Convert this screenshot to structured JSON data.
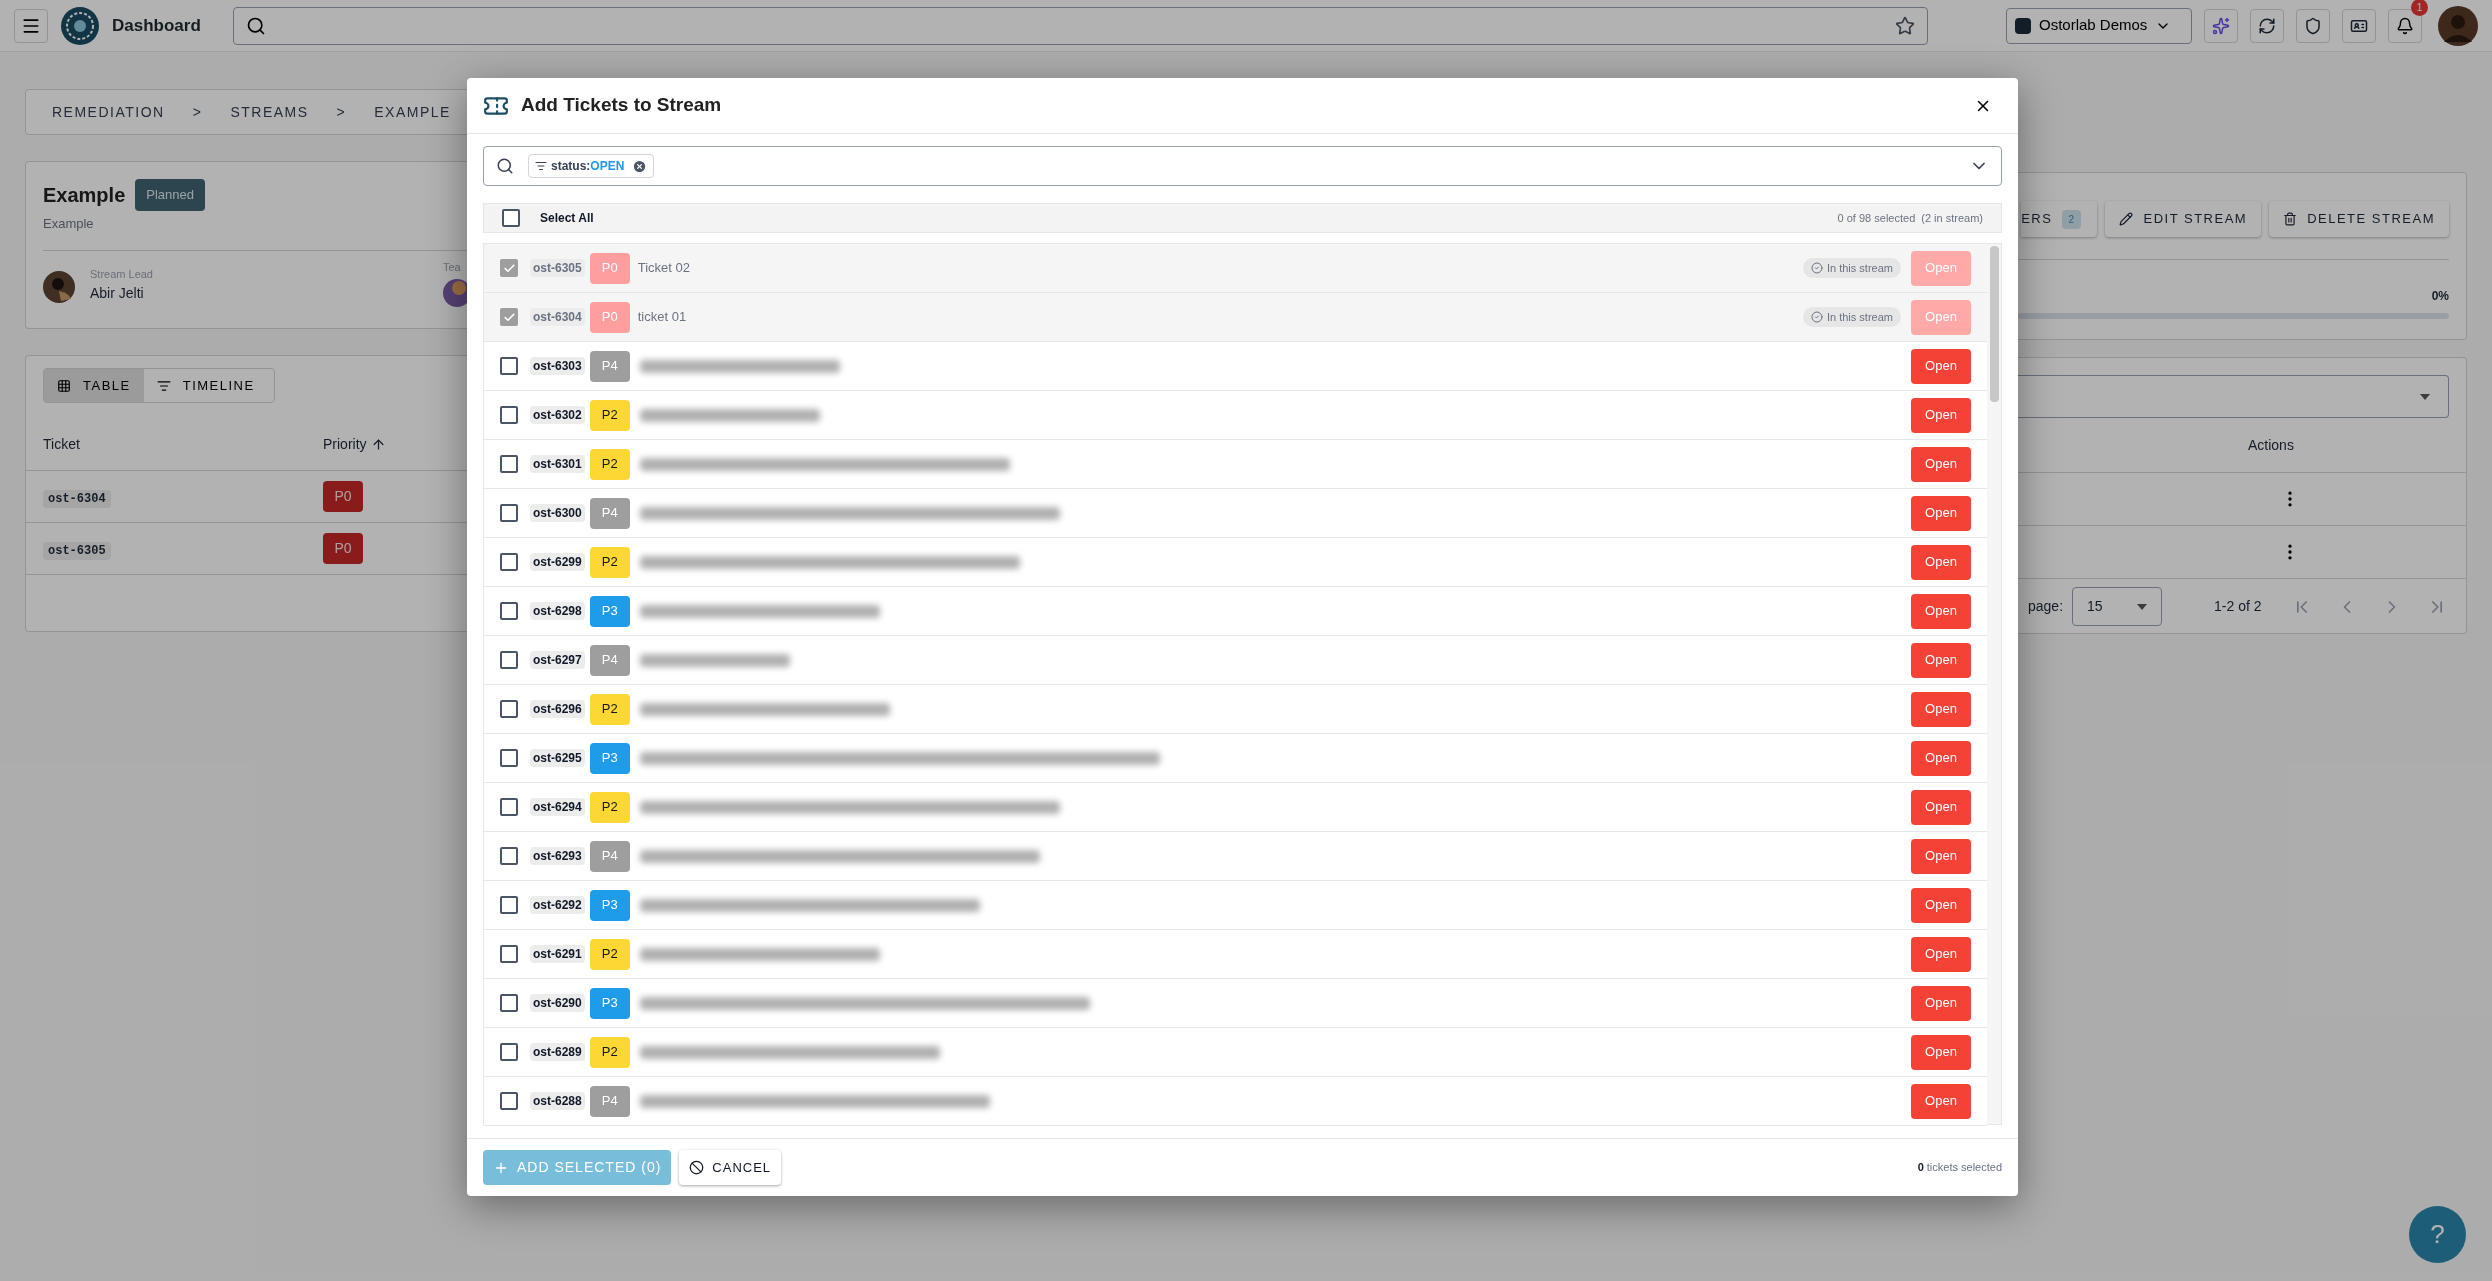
{
  "top_bar": {
    "title": "Dashboard",
    "org": "Ostorlab Demos",
    "notifications": "1"
  },
  "breadcrumb": [
    "REMEDIATION",
    ">",
    "STREAMS",
    ">",
    "EXAMPLE"
  ],
  "stream": {
    "name": "Example",
    "status": "Planned",
    "description": "Example",
    "lead_label": "Stream Lead",
    "lead": "Abir Jelti",
    "team_label": "Tea",
    "buttons": [
      {
        "kind": "count",
        "label": "ERS",
        "count": "2"
      },
      {
        "kind": "edit",
        "label": "EDIT STREAM"
      },
      {
        "kind": "delete",
        "label": "DELETE STREAM"
      }
    ],
    "progress": {
      "level": 0,
      "reading": "0%"
    }
  },
  "view_tabs": [
    {
      "kind": "table",
      "label": "TABLE",
      "selected": true
    },
    {
      "kind": "timeline",
      "label": "TIMELINE",
      "selected": false
    }
  ],
  "table": {
    "columns": [
      "Ticket",
      "Priority"
    ],
    "actions_column": "Actions",
    "rows": [
      {
        "ticket": "ost-6304",
        "priority": "P0"
      },
      {
        "ticket": "ost-6305",
        "priority": "P0"
      }
    ]
  },
  "pagination": {
    "rows_label": "page:",
    "per_page": "15",
    "range": "1-2 of 2"
  },
  "help": "?",
  "dialog": {
    "title": "Add Tickets to Stream",
    "filter": {
      "key": "status:",
      "value": "OPEN"
    },
    "select_all": {
      "label": "Select All",
      "checked": false
    },
    "selection_summary": "0 of 98 selected",
    "stream_summary": "(2 in stream)",
    "rows": [
      {
        "id": "ost-6305",
        "priority": "P0",
        "color": "#ff9e9e",
        "title": "Ticket 02",
        "note": "In this stream",
        "in_stream": true,
        "checked": true,
        "status": "Open"
      },
      {
        "id": "ost-6304",
        "priority": "P0",
        "color": "#ff9e9e",
        "title": "ticket 01",
        "note": "In this stream",
        "in_stream": true,
        "checked": true,
        "status": "Open"
      },
      {
        "id": "ost-6303",
        "priority": "P4",
        "color": "#9e9e9e",
        "title_blurred": true,
        "in_stream": false,
        "checked": false,
        "status": "Open"
      },
      {
        "id": "ost-6302",
        "priority": "P2",
        "color": "#fdd835",
        "title_blurred": true,
        "in_stream": false,
        "checked": false,
        "status": "Open"
      },
      {
        "id": "ost-6301",
        "priority": "P2",
        "color": "#fdd835",
        "title_blurred": true,
        "in_stream": false,
        "checked": false,
        "status": "Open"
      },
      {
        "id": "ost-6300",
        "priority": "P4",
        "color": "#9e9e9e",
        "title_blurred": true,
        "in_stream": false,
        "checked": false,
        "status": "Open"
      },
      {
        "id": "ost-6299",
        "priority": "P2",
        "color": "#fdd835",
        "title_blurred": true,
        "in_stream": false,
        "checked": false,
        "status": "Open"
      },
      {
        "id": "ost-6298",
        "priority": "P3",
        "color": "#1e9be9",
        "title_blurred": true,
        "in_stream": false,
        "checked": false,
        "status": "Open"
      },
      {
        "id": "ost-6297",
        "priority": "P4",
        "color": "#9e9e9e",
        "title_blurred": true,
        "in_stream": false,
        "checked": false,
        "status": "Open"
      },
      {
        "id": "ost-6296",
        "priority": "P2",
        "color": "#fdd835",
        "title_blurred": true,
        "in_stream": false,
        "checked": false,
        "status": "Open"
      },
      {
        "id": "ost-6295",
        "priority": "P3",
        "color": "#1e9be9",
        "title_blurred": true,
        "in_stream": false,
        "checked": false,
        "status": "Open"
      },
      {
        "id": "ost-6294",
        "priority": "P2",
        "color": "#fdd835",
        "title_blurred": true,
        "in_stream": false,
        "checked": false,
        "status": "Open"
      },
      {
        "id": "ost-6293",
        "priority": "P4",
        "color": "#9e9e9e",
        "title_blurred": true,
        "in_stream": false,
        "checked": false,
        "status": "Open"
      },
      {
        "id": "ost-6292",
        "priority": "P3",
        "color": "#1e9be9",
        "title_blurred": true,
        "in_stream": false,
        "checked": false,
        "status": "Open"
      },
      {
        "id": "ost-6291",
        "priority": "P2",
        "color": "#fdd835",
        "title_blurred": true,
        "in_stream": false,
        "checked": false,
        "status": "Open"
      },
      {
        "id": "ost-6290",
        "priority": "P3",
        "color": "#1e9be9",
        "title_blurred": true,
        "in_stream": false,
        "checked": false,
        "status": "Open"
      },
      {
        "id": "ost-6289",
        "priority": "P2",
        "color": "#fdd835",
        "title_blurred": true,
        "in_stream": false,
        "checked": false,
        "status": "Open"
      },
      {
        "id": "ost-6288",
        "priority": "P4",
        "color": "#9e9e9e",
        "title_blurred": true,
        "in_stream": false,
        "checked": false,
        "status": "Open"
      }
    ],
    "add_button": "ADD SELECTED (0)",
    "cancel_button": "CANCEL",
    "footer_count": "0",
    "footer_text": "tickets selected"
  }
}
